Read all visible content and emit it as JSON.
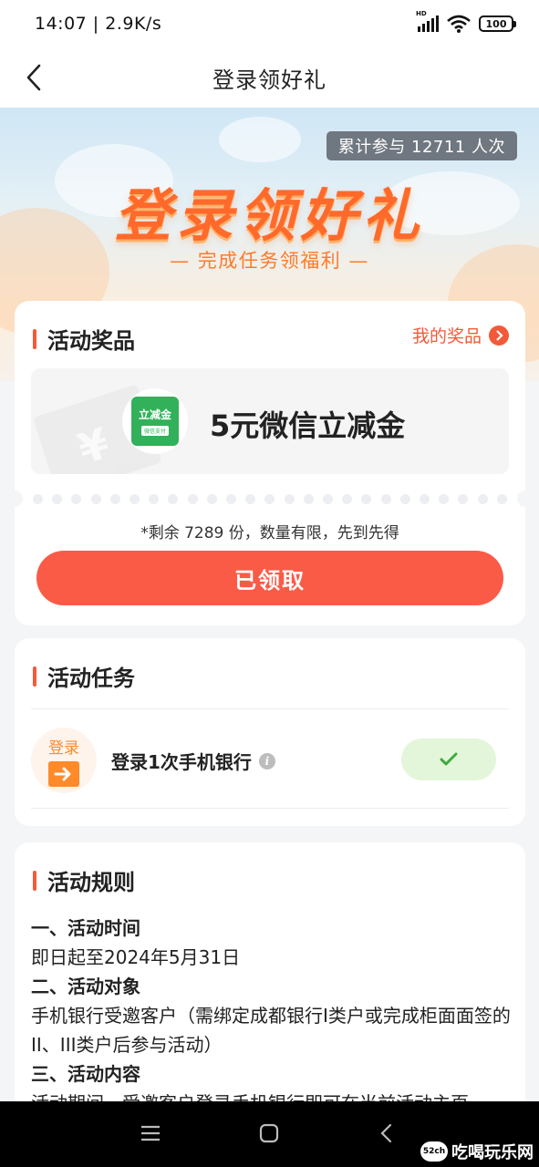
{
  "status_bar": {
    "time_speed": "14:07 | 2.9K/s",
    "signal_label": "HD",
    "battery": "100"
  },
  "nav": {
    "title": "登录领好礼"
  },
  "hero": {
    "participants": "累计参与 12711 人次",
    "title": "登录领好礼",
    "subtitle": "— 完成任务领福利 —"
  },
  "prize": {
    "section_title": "活动奖品",
    "my_prize_link": "我的奖品",
    "coupon_label": "立减金",
    "coupon_sub": "微信支付",
    "name": "5元微信立减金",
    "remaining": "*剩余 7289 份，数量有限，先到先得",
    "claim_button": "已领取"
  },
  "task": {
    "section_title": "活动任务",
    "icon_label": "登录",
    "name": "登录1次手机银行",
    "info_glyph": "i",
    "status": "completed"
  },
  "rules": {
    "section_title": "活动规则",
    "h1": "一、活动时间",
    "p1": "即日起至2024年5月31日",
    "h2": "二、活动对象",
    "p2": "手机银行受邀客户（需绑定成都银行I类户或完成柜面面签的II、III类户后参与活动）",
    "h3": "三、活动内容",
    "p3": "活动期间，受邀客户登录手机银行即可在当前活动主页"
  },
  "watermark": {
    "logo": "52ch",
    "text": "吃喝玩乐网"
  },
  "colors": {
    "accent": "#fa5b47",
    "hero_title": "#ff6a2a",
    "done_bg": "#e3f6da",
    "check": "#3caa3c"
  }
}
